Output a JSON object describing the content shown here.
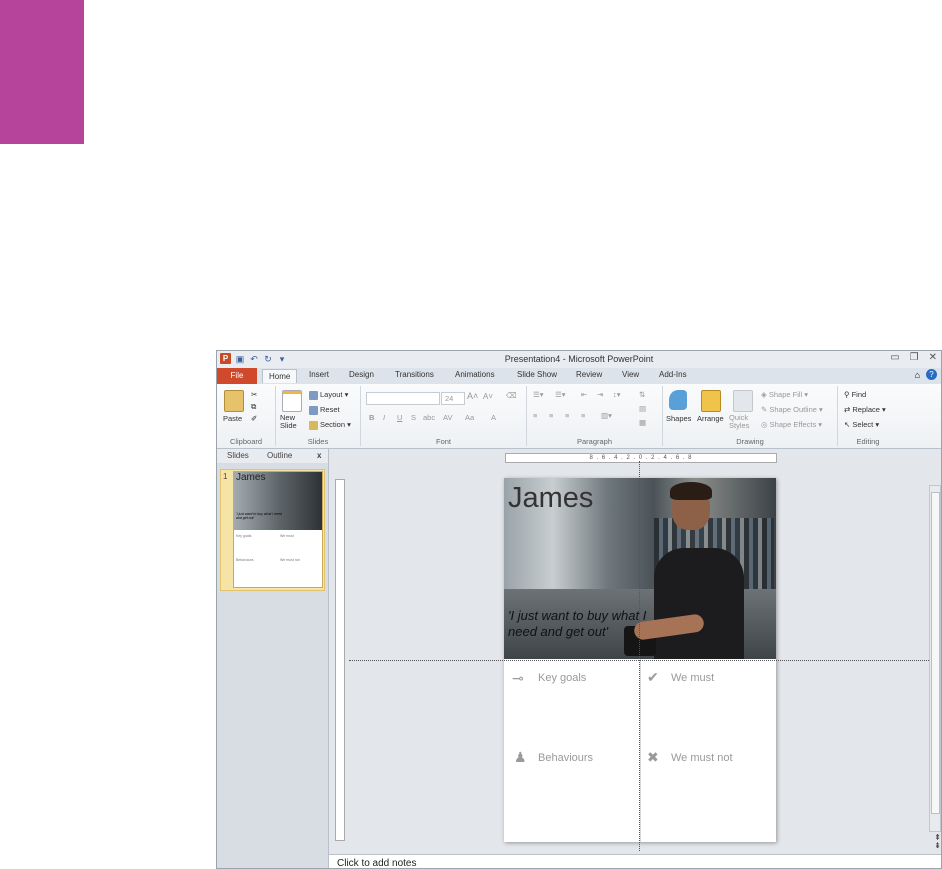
{
  "window": {
    "title": "Presentation4 - Microsoft PowerPoint"
  },
  "ribbon_tabs": [
    "File",
    "Home",
    "Insert",
    "Design",
    "Transitions",
    "Animations",
    "Slide Show",
    "Review",
    "View",
    "Add-Ins"
  ],
  "ribbon": {
    "clipboard": {
      "paste": "Paste",
      "group": "Clipboard"
    },
    "slides": {
      "new_slide": "New Slide",
      "layout": "Layout",
      "reset": "Reset",
      "section": "Section",
      "group": "Slides"
    },
    "font": {
      "size": "24",
      "bold": "B",
      "italic": "I",
      "underline": "U",
      "strike": "S",
      "shadow": "abc",
      "spacing": "AV",
      "case": "Aa",
      "grow": "A",
      "shrink": "A",
      "font_color": "A",
      "group": "Font"
    },
    "paragraph": {
      "group": "Paragraph"
    },
    "drawing": {
      "shapes": "Shapes",
      "arrange": "Arrange",
      "quick_styles": "Quick Styles",
      "shape_fill": "Shape Fill",
      "shape_outline": "Shape Outline",
      "shape_effects": "Shape Effects",
      "group": "Drawing"
    },
    "editing": {
      "find": "Find",
      "replace": "Replace",
      "select": "Select",
      "group": "Editing"
    }
  },
  "left_pane": {
    "tab_slides": "Slides",
    "tab_outline": "Outline",
    "close": "x",
    "slide_number": "1"
  },
  "thumbnail": {
    "title": "James",
    "quote": "'I just want to buy what I need and get out'",
    "goals": "Key goals",
    "must": "We must",
    "behaviours": "Behaviours",
    "must_not": "We must not"
  },
  "ruler": {
    "h": "8 . 6 . 4 . 2 . 0 . 2 . 4 . 6 . 8"
  },
  "slide": {
    "title": "James",
    "quote": "'I just want to buy what I need and get out'",
    "cells": {
      "key_goals": "Key goals",
      "we_must": "We must",
      "behaviours": "Behaviours",
      "we_must_not": "We must not"
    }
  },
  "notes": {
    "placeholder": "Click to add notes"
  },
  "colors": {
    "accent_block": "#b5449a",
    "file_tab": "#d0492b"
  }
}
